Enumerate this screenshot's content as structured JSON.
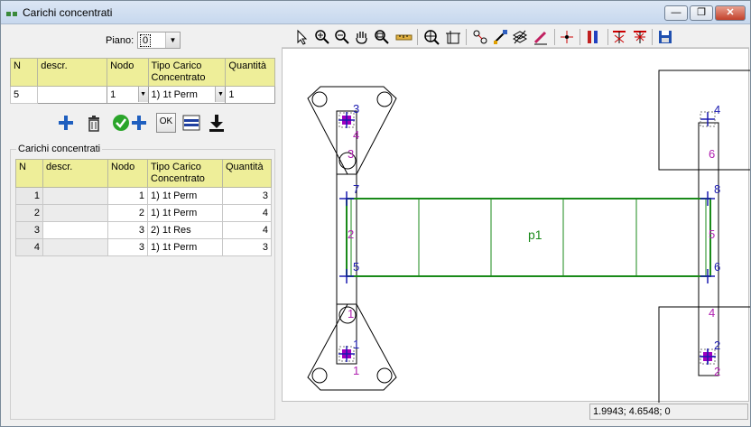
{
  "window": {
    "title": "Carichi concentrati",
    "buttons": [
      "—",
      "❐",
      "✕"
    ]
  },
  "form": {
    "piano_label": "Piano:",
    "piano_value": "0"
  },
  "edit_table": {
    "headers": [
      "N",
      "descr.",
      "Nodo",
      "Tipo Carico Concentrato",
      "Quantità"
    ],
    "row": {
      "n": "5",
      "descr": "",
      "nodo": "1",
      "tipo": "1) 1t Perm",
      "quantita": "1"
    }
  },
  "actions": {
    "ok_label": "OK",
    "icons": [
      "add-icon",
      "delete-icon",
      "confirm-add-icon",
      "list-icon",
      "download-icon"
    ]
  },
  "list": {
    "group_label": "Carichi concentrati",
    "headers": [
      "N",
      "descr.",
      "Nodo",
      "Tipo Carico Concentrato",
      "Quantità"
    ],
    "rows": [
      {
        "n": "1",
        "descr": "",
        "nodo": "1",
        "tipo": "1) 1t Perm",
        "quantita": "3"
      },
      {
        "n": "2",
        "descr": "",
        "nodo": "2",
        "tipo": "1) 1t Perm",
        "quantita": "4"
      },
      {
        "n": "3",
        "descr": "",
        "nodo": "3",
        "tipo": "2) 1t Res",
        "quantita": "4"
      },
      {
        "n": "4",
        "descr": "",
        "nodo": "3",
        "tipo": "1) 1t Perm",
        "quantita": "3"
      }
    ]
  },
  "drawing": {
    "panel_label": "p1",
    "node_labels": [
      "1",
      "2",
      "3",
      "4",
      "5",
      "6",
      "7",
      "8"
    ],
    "element_labels": [
      "1",
      "2",
      "3",
      "4",
      "5",
      "6"
    ],
    "colors": {
      "node": "#1a1ab0",
      "element": "#b020b0",
      "panel": "#1a8a1a",
      "load": "#a000a0"
    }
  },
  "status": {
    "coords": "1.9943; 4.6548; 0"
  }
}
